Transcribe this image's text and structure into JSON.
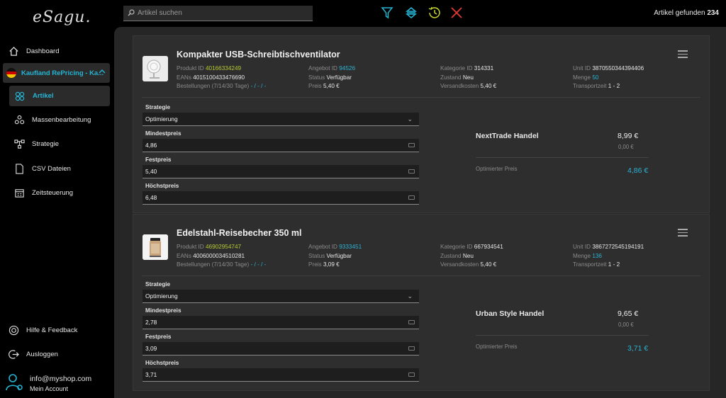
{
  "app": {
    "logo": "eSagu."
  },
  "sidebar": {
    "items": [
      {
        "label": "Dashboard",
        "icon": "home-icon"
      },
      {
        "label": "Kaufland RePricing - Ka...",
        "icon": "germany-flag-icon"
      },
      {
        "label": "Artikel",
        "icon": "articles-icon"
      },
      {
        "label": "Massenbearbeitung",
        "icon": "bulk-edit-icon"
      },
      {
        "label": "Strategie",
        "icon": "strategy-icon"
      },
      {
        "label": "CSV Dateien",
        "icon": "file-icon"
      },
      {
        "label": "Zeitsteuerung",
        "icon": "calendar-icon"
      },
      {
        "label": "Hilfe & Feedback",
        "icon": "help-icon"
      },
      {
        "label": "Ausloggen",
        "icon": "logout-icon"
      }
    ],
    "account": {
      "email": "info@myshop.com",
      "label": "Mein Account"
    }
  },
  "topbar": {
    "search_placeholder": "Artikel suchen",
    "icons": [
      "filter-icon",
      "sort-icon",
      "history-icon",
      "clear-filter-icon"
    ],
    "results_label": "Artikel gefunden",
    "results_count": "234"
  },
  "colors": {
    "accent": "#25b5d4",
    "product_id": "#b5c835",
    "clear": "#e53935",
    "filter": "#25b5d4",
    "history": "#c8d630"
  },
  "products": [
    {
      "title": "Kompakter USB-Schreibtischventilator",
      "produkt_id_label": "Produkt ID",
      "produkt_id": "40166334249",
      "eans_label": "EANs",
      "eans": "4015100433476690",
      "bestellungen_label": "Bestellungen (7/14/30 Tage)",
      "bestellungen": "- / - / -",
      "angebot_id_label": "Angebot ID",
      "angebot_id": "94526",
      "status_label": "Status",
      "status": "Verfügbar",
      "preis_label": "Preis",
      "preis": "5,40 €",
      "kategorie_id_label": "Kategorie ID",
      "kategorie_id": "314331",
      "zustand_label": "Zustand",
      "zustand": "Neu",
      "versandkosten_label": "Versandkosten",
      "versandkosten": "5,40 €",
      "unit_id_label": "Unit ID",
      "unit_id": "3870550344394406",
      "menge_label": "Menge",
      "menge": "50",
      "transportzeit_label": "Transportzeit",
      "transportzeit": "1 - 2",
      "strategie_label": "Strategie",
      "strategie": "Optimierung",
      "mindestpreis_label": "Mindestpreis",
      "mindestpreis": "4,86",
      "festpreis_label": "Festpreis",
      "festpreis": "5,40",
      "hoechstpreis_label": "Höchstpreis",
      "hoechstpreis": "6,48",
      "competitor": "NextTrade Handel",
      "competitor_price": "8,99 €",
      "competitor_ship": "0,00 €",
      "optimized_label": "Optimierter Preis",
      "optimized_price": "4,86 €"
    },
    {
      "title": "Edelstahl-Reisebecher 350 ml",
      "produkt_id_label": "Produkt ID",
      "produkt_id": "46902954747",
      "eans_label": "EANs",
      "eans": "4006000034510281",
      "bestellungen_label": "Bestellungen (7/14/30 Tage)",
      "bestellungen": "- / - / -",
      "angebot_id_label": "Angebot ID",
      "angebot_id": "9333451",
      "status_label": "Status",
      "status": "Verfügbar",
      "preis_label": "Preis",
      "preis": "3,09 €",
      "kategorie_id_label": "Kategorie ID",
      "kategorie_id": "667934541",
      "zustand_label": "Zustand",
      "zustand": "Neu",
      "versandkosten_label": "Versandkosten",
      "versandkosten": "5,40 €",
      "unit_id_label": "Unit ID",
      "unit_id": "3867272545194191",
      "menge_label": "Menge",
      "menge": "136",
      "transportzeit_label": "Transportzeit",
      "transportzeit": "1 - 2",
      "strategie_label": "Strategie",
      "strategie": "Optimierung",
      "mindestpreis_label": "Mindestpreis",
      "mindestpreis": "2,78",
      "festpreis_label": "Festpreis",
      "festpreis": "3,09",
      "hoechstpreis_label": "Höchstpreis",
      "hoechstpreis": "3,71",
      "competitor": "Urban Style Handel",
      "competitor_price": "9,65 €",
      "competitor_ship": "0,00 €",
      "optimized_label": "Optimierter Preis",
      "optimized_price": "3,71 €"
    }
  ]
}
